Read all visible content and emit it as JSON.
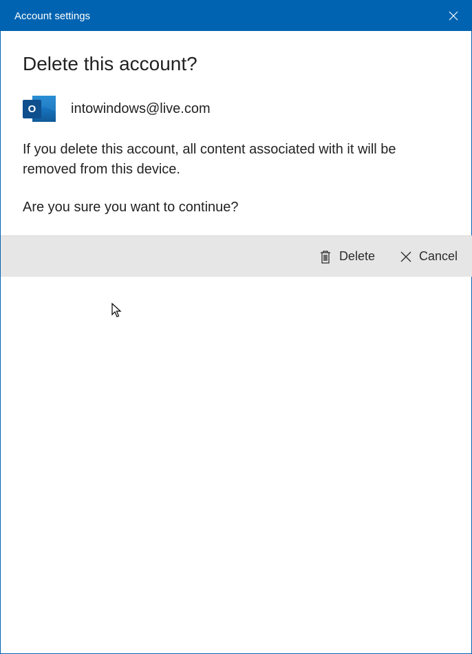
{
  "titlebar": {
    "title": "Account settings"
  },
  "heading": "Delete this account?",
  "account": {
    "email": "intowindows@live.com",
    "icon_badge": "O"
  },
  "messages": {
    "warning": "If you delete this account, all content associated with it will be removed from this device.",
    "confirm": "Are you sure you want to continue?"
  },
  "footer": {
    "delete_label": "Delete",
    "cancel_label": "Cancel"
  }
}
